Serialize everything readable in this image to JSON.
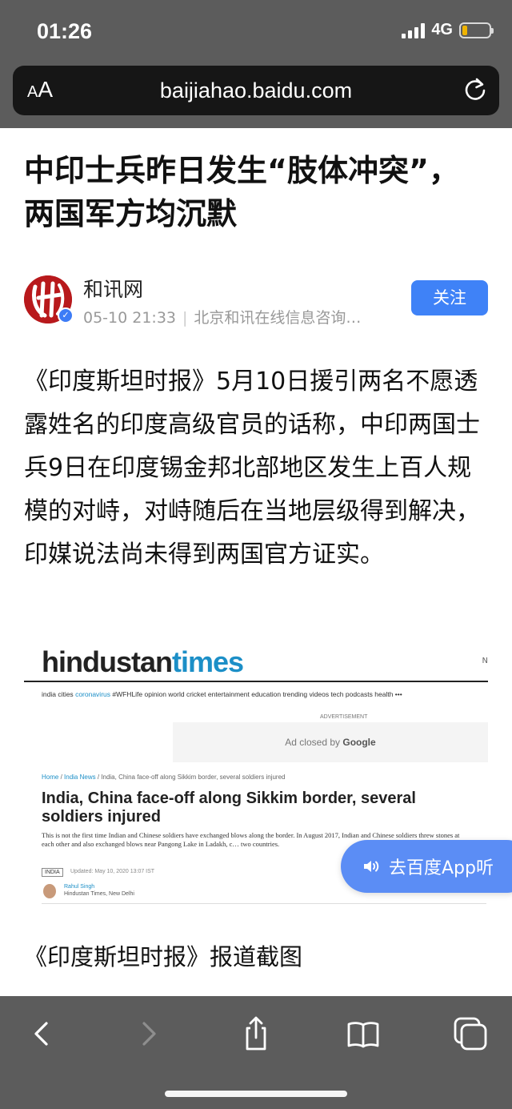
{
  "status_bar": {
    "time": "01:26",
    "network": "4G",
    "battery_level": 0.2
  },
  "browser": {
    "text_size_label_small": "A",
    "text_size_label_big": "A",
    "url": "baijiahao.baidu.com"
  },
  "article": {
    "headline": "中印士兵昨日发生“肢体冲突”，两国军方均沉默",
    "author_name": "和讯网",
    "publish_time": "05-10 21:33",
    "source": "北京和讯在线信息咨询…",
    "follow_label": "关注",
    "body": "《印度斯坦时报》5月10日援引两名不愿透露姓名的印度高级官员的话称，中印两国士兵9日在印度锡金邦北部地区发生上百人规模的对峙，对峙随后在当地层级得到解决，印媒说法尚未得到两国官方证实。",
    "caption": "《印度斯坦时报》报道截图"
  },
  "embedded_screenshot": {
    "logo_part1": "hindustan",
    "logo_part2": "times",
    "corner_text": "N",
    "nav_before": "india   cities   ",
    "nav_highlight": "coronavirus",
    "nav_after": "   #WFHLife   opinion   world   cricket   entertainment   education   trending   videos   tech   podcasts   health   •••",
    "advertisement_label": "ADVERTISEMENT",
    "ad_closed_text": "Ad closed by",
    "ad_closed_brand": "Google",
    "crumb_home": "Home",
    "crumb_section": "India News",
    "crumb_rest": "/ India, China face-off along Sikkim border, several soldiers injured",
    "title": "India, China face-off along Sikkim border, several soldiers injured",
    "description": "This is not the first time Indian and Chinese soldiers have exchanged blows along the border. In August 2017, Indian and Chinese soldiers threw stones at each other and also exchanged blows near Pangong Lake in Ladakh, c… two countries.",
    "tag": "INDIA",
    "updated": "Updated: May 10, 2020 13:07 IST",
    "writer_name": "Rahul Singh",
    "writer_org": "Hindustan Times, New Delhi"
  },
  "listen_button": {
    "label": "去百度App听"
  },
  "toolbar": {
    "icons": [
      "back-icon",
      "forward-icon",
      "share-icon",
      "bookmarks-icon",
      "tabs-icon"
    ]
  }
}
